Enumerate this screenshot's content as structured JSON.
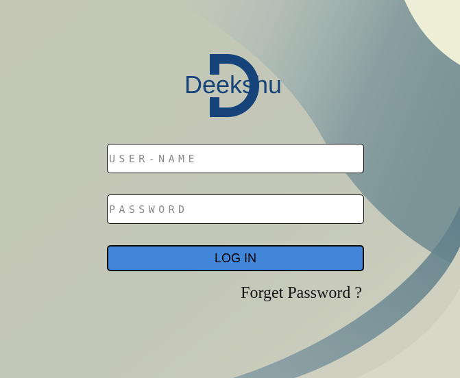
{
  "brand": {
    "logo_text": "Deekshu",
    "logo_color": "#15437a"
  },
  "login_form": {
    "username_placeholder": "USER-NAME",
    "password_placeholder": "PASSWORD",
    "login_label": "LOG IN",
    "forgot_label": "Forget Password ?"
  },
  "colors": {
    "button": "#4286da",
    "field_background": "#ffffff",
    "background": "#c6c8b6"
  }
}
